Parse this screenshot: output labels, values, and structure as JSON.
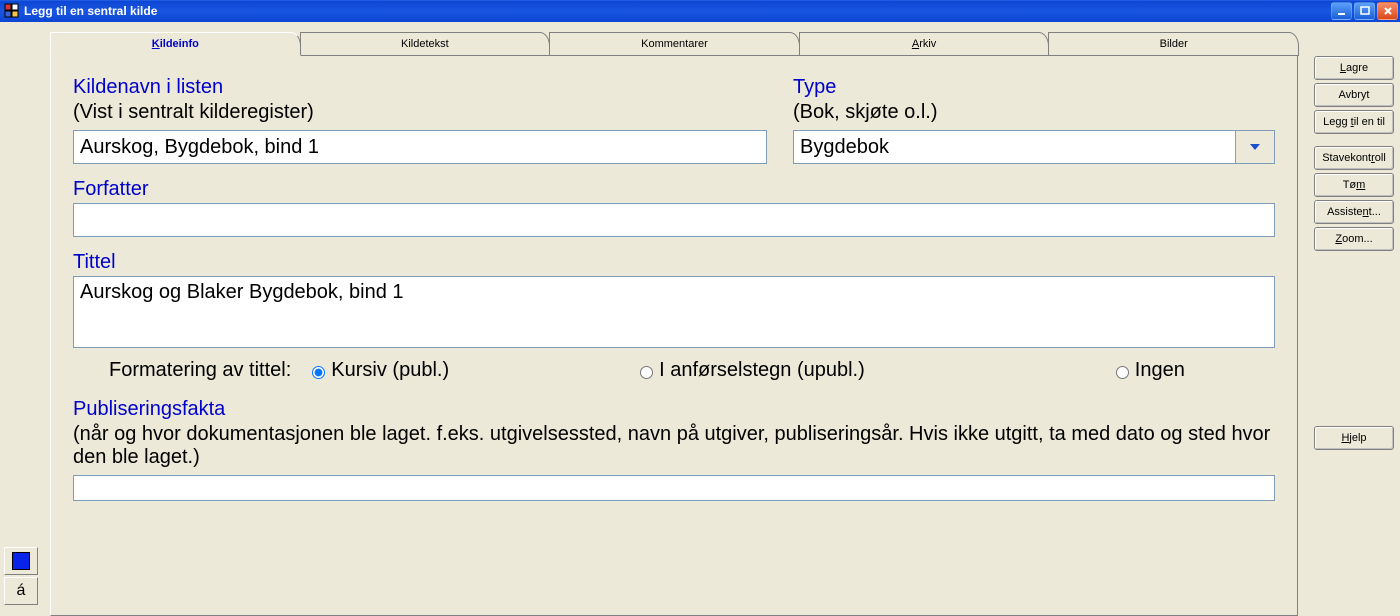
{
  "window": {
    "title": "Legg til en sentral kilde"
  },
  "tabs": [
    {
      "label_pre": "",
      "key": "K",
      "label_post": "ildeinfo",
      "active": true
    },
    {
      "label_pre": "Kildetekst",
      "key": "",
      "label_post": "",
      "active": false
    },
    {
      "label_pre": "Kommentarer",
      "key": "",
      "label_post": "",
      "active": false
    },
    {
      "label_pre": "",
      "key": "A",
      "label_post": "rkiv",
      "active": false
    },
    {
      "label_pre": "Bilder",
      "key": "",
      "label_post": "",
      "active": false
    }
  ],
  "labels": {
    "kildenavn_header": "Kildenavn i listen",
    "kildenavn_sub": "(Vist i sentralt kilderegister)",
    "type_header": "Type",
    "type_sub": "(Bok, skjøte o.l.)",
    "forfatter_header": "Forfatter",
    "tittel_header": "Tittel",
    "format_label": "Formatering av tittel:",
    "radio_kursiv": "Kursiv (publ.)",
    "radio_anforsel": "I anførselstegn (upubl.)",
    "radio_ingen": "Ingen",
    "publ_header": "Publiseringsfakta",
    "publ_sub": "(når og hvor dokumentasjonen ble laget. f.eks. utgivelsessted, navn på utgiver, publiseringsår. Hvis ikke utgitt, ta med dato og sted hvor den ble laget.)"
  },
  "values": {
    "kildenavn": "Aurskog, Bygdebok, bind 1",
    "type": "Bygdebok",
    "forfatter": "",
    "tittel": "Aurskog og Blaker Bygdebok, bind 1",
    "publ": "",
    "format_selected": "kursiv"
  },
  "sidebar": {
    "char_a": "á"
  },
  "buttons": {
    "lagre_pre": "",
    "lagre_key": "L",
    "lagre_post": "agre",
    "avbryt": "Avbryt",
    "leggtil_pre": "Legg ",
    "leggtil_key": "t",
    "leggtil_post": "il en til",
    "stave_pre": "Stavekont",
    "stave_key": "r",
    "stave_post": "oll",
    "tom_pre": "Tø",
    "tom_key": "m",
    "tom_post": "",
    "assist_pre": "Assiste",
    "assist_key": "n",
    "assist_post": "t...",
    "zoom_pre": "",
    "zoom_key": "Z",
    "zoom_post": "oom...",
    "hjelp_pre": "",
    "hjelp_key": "H",
    "hjelp_post": "jelp"
  }
}
